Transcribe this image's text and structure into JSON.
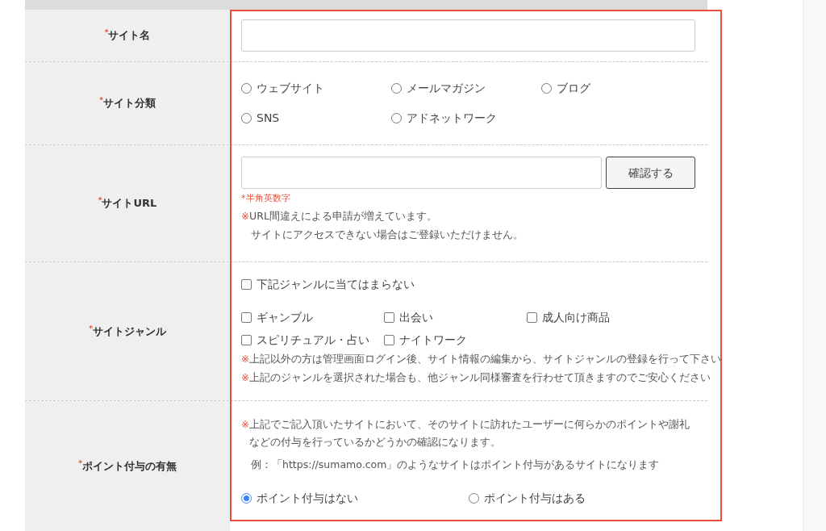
{
  "form_rows": [
    {
      "kind": "text",
      "required_mark": "*",
      "label": "サイト名",
      "field": {}
    },
    {
      "kind": "radios",
      "required_mark": "*",
      "label": "サイト分類",
      "options": [
        {
          "label": "ウェブサイト",
          "selected": false
        },
        {
          "label": "メールマガジン",
          "selected": false
        },
        {
          "label": "ブログ",
          "selected": false
        },
        {
          "label": "SNS",
          "selected": false
        },
        {
          "label": "アドネットワーク",
          "selected": false
        }
      ]
    },
    {
      "kind": "url",
      "required_mark": "*",
      "label": "サイトURL",
      "field": {},
      "button": "確認する",
      "hint": "*半角英数字",
      "notes": [
        {
          "mark": "※",
          "text": "URL間違えによる申請が増えています。"
        },
        {
          "text": "サイトにアクセスできない場合はご登録いただけません。"
        }
      ]
    },
    {
      "kind": "checks",
      "required_mark": "*",
      "label": "サイトジャンル",
      "exclusive": {
        "label": "下記ジャンルに当てはまらない",
        "checked": false
      },
      "options": [
        {
          "label": "ギャンブル",
          "checked": false
        },
        {
          "label": "出会い",
          "checked": false
        },
        {
          "label": "成人向け商品",
          "checked": false
        },
        {
          "label": "スピリチュアル・占い",
          "checked": false
        },
        {
          "label": "ナイトワーク",
          "checked": false
        }
      ],
      "notes": [
        {
          "mark": "※",
          "text": "上記以外の方は管理画面ログイン後、サイト情報の編集から、サイトジャンルの登録を行って下さい"
        },
        {
          "mark": "※",
          "text": "上記のジャンルを選択された場合も、他ジャンル同様審査を行わせて頂きますのでご安心ください"
        }
      ]
    },
    {
      "kind": "point",
      "required_mark": "*",
      "label": "ポイント付与の有無",
      "notes": [
        {
          "mark": "※",
          "text": "上記でご記入頂いたサイトにおいて、そのサイトに訪れたユーザーに何らかのポイントや謝礼などの付与を行っているかどうかの確認になります。"
        },
        {
          "text": "例：「https://sumamo.com」のようなサイトはポイント付与があるサイトになります"
        }
      ],
      "options": [
        {
          "label": "ポイント付与はない",
          "selected": true
        },
        {
          "label": "ポイント付与はある",
          "selected": false
        }
      ]
    }
  ]
}
